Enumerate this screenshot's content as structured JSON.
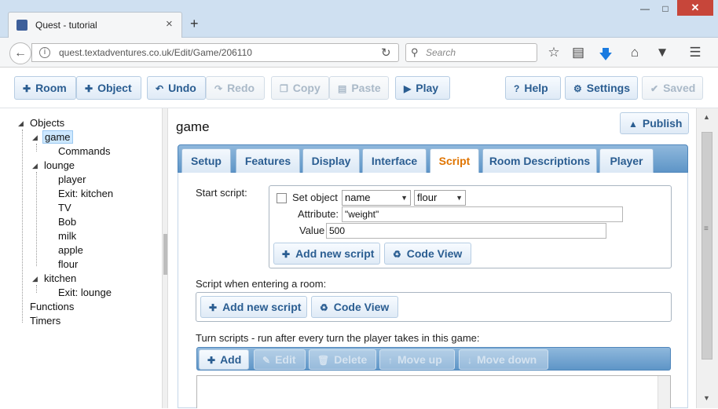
{
  "browser": {
    "tab_title": "Quest - tutorial",
    "url": "quest.textadventures.co.uk/Edit/Game/206110",
    "search_placeholder": "Search",
    "new_tab": "+",
    "tab_close": "×"
  },
  "toolbar": {
    "room": "Room",
    "object": "Object",
    "undo": "Undo",
    "redo": "Redo",
    "copy": "Copy",
    "paste": "Paste",
    "play": "Play",
    "help": "Help",
    "settings": "Settings",
    "saved": "Saved"
  },
  "tree": {
    "objects": "Objects",
    "game": "game",
    "commands": "Commands",
    "lounge": "lounge",
    "lounge_children": [
      "player",
      "Exit: kitchen",
      "TV",
      "Bob",
      "milk",
      "apple",
      "flour"
    ],
    "kitchen": "kitchen",
    "kitchen_exit": "Exit: lounge",
    "functions": "Functions",
    "timers": "Timers"
  },
  "editor": {
    "title": "game",
    "publish": "Publish",
    "tabs": [
      "Setup",
      "Features",
      "Display",
      "Interface",
      "Script",
      "Room Descriptions",
      "Player"
    ],
    "active_tab": "Script",
    "start_script_label": "Start script:",
    "set_object_label": "Set object",
    "set_object_select1": "name",
    "set_object_select2": "flour",
    "attribute_label": "Attribute:",
    "attribute_value": "\"weight\"",
    "value_label": "Value",
    "value_value": "500",
    "add_new_script": "Add new script",
    "code_view": "Code View",
    "enter_room_label": "Script when entering a room:",
    "turn_scripts_label": "Turn scripts - run after every turn the player takes in this game:",
    "turn_add": "Add",
    "turn_edit": "Edit",
    "turn_delete": "Delete",
    "turn_move_up": "Move up",
    "turn_move_down": "Move down"
  }
}
